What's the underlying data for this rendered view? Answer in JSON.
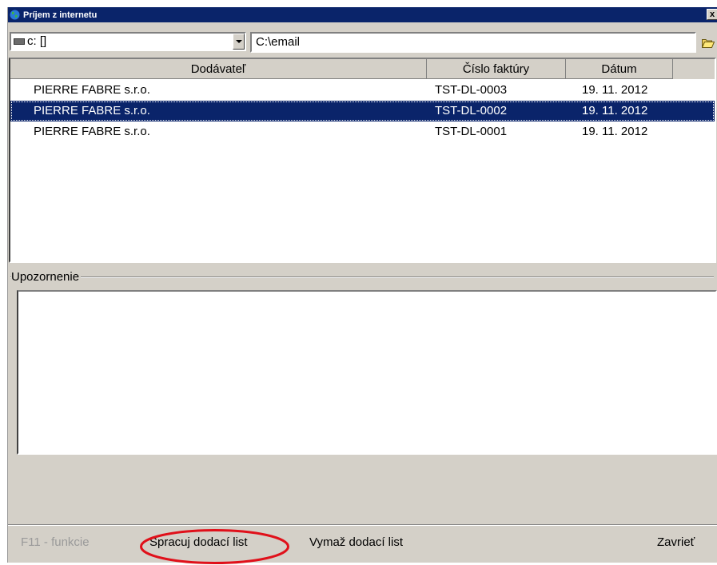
{
  "window": {
    "title": "Príjem z internetu",
    "close_label": "x"
  },
  "path_bar": {
    "drive_value": "c: []",
    "path_value": "C:\\email"
  },
  "table": {
    "columns": [
      "Dodávateľ",
      "Číslo faktúry",
      "Dátum"
    ],
    "rows": [
      {
        "supplier": "PIERRE FABRE s.r.o.",
        "invoice": "TST-DL-0003",
        "date": "19. 11. 2012",
        "selected": false
      },
      {
        "supplier": "PIERRE FABRE s.r.o.",
        "invoice": "TST-DL-0002",
        "date": "19. 11. 2012",
        "selected": true
      },
      {
        "supplier": "PIERRE FABRE s.r.o.",
        "invoice": "TST-DL-0001",
        "date": "19. 11. 2012",
        "selected": false
      }
    ]
  },
  "warning": {
    "label": "Upozornenie",
    "text": ""
  },
  "buttons": {
    "f11": "F11 - funkcie",
    "process": "Spracuj dodací list",
    "delete": "Vymaž dodací list",
    "close": "Zavrieť"
  },
  "colors": {
    "selection": "#0a246a",
    "annotation": "#e0101a",
    "face": "#d4d0c8"
  },
  "icons": {
    "app": "globe-icon",
    "drive": "drive-icon",
    "folder": "folder-open-icon"
  }
}
